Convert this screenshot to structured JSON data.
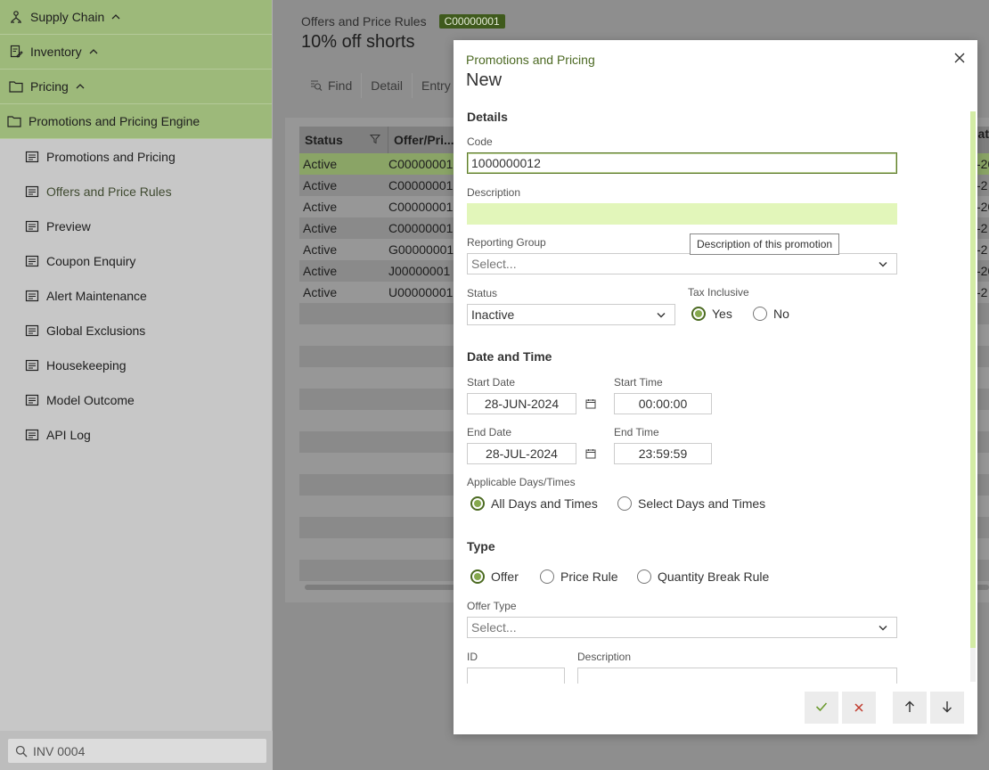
{
  "sidebar": {
    "groups": [
      {
        "label": "Supply Chain",
        "icon": "supply-chain-icon"
      },
      {
        "label": "Inventory",
        "icon": "inventory-icon"
      },
      {
        "label": "Pricing",
        "icon": "folder-icon"
      },
      {
        "label": "Promotions and Pricing Engine",
        "icon": "folder-icon"
      }
    ],
    "items": [
      {
        "label": "Promotions and Pricing"
      },
      {
        "label": "Offers and Price Rules"
      },
      {
        "label": "Preview"
      },
      {
        "label": "Coupon Enquiry"
      },
      {
        "label": "Alert Maintenance"
      },
      {
        "label": "Global Exclusions"
      },
      {
        "label": "Housekeeping"
      },
      {
        "label": "Model Outcome"
      },
      {
        "label": "API Log"
      }
    ],
    "search_value": "INV 0004"
  },
  "page": {
    "breadcrumb": "Offers and Price Rules",
    "code_badge": "C00000001",
    "title": "10% off shorts",
    "toolbar": {
      "find": "Find",
      "detail": "Detail",
      "entry": "Entry"
    }
  },
  "grid": {
    "columns": [
      "Status",
      "Offer/Pri..."
    ],
    "rows": [
      {
        "status": "Active",
        "code": "C00000001",
        "end": "-20"
      },
      {
        "status": "Active",
        "code": "C00000001",
        "end": "-2"
      },
      {
        "status": "Active",
        "code": "C00000001",
        "end": "-20"
      },
      {
        "status": "Active",
        "code": "C00000001",
        "end": "-2"
      },
      {
        "status": "Active",
        "code": "G00000001",
        "end": "-2"
      },
      {
        "status": "Active",
        "code": "J00000001",
        "end": "-20"
      },
      {
        "status": "Active",
        "code": "U00000001",
        "end": "-2"
      }
    ],
    "right_header": "at"
  },
  "modal": {
    "subtitle": "Promotions and Pricing",
    "title": "New",
    "details_heading": "Details",
    "code_label": "Code",
    "code_value": "1000000012",
    "description_label": "Description",
    "description_value": "",
    "tooltip": "Description of this promotion",
    "reporting_group_label": "Reporting Group",
    "reporting_group_placeholder": "Select...",
    "status_label": "Status",
    "status_value": "Inactive",
    "tax_inclusive_label": "Tax Inclusive",
    "tax_yes": "Yes",
    "tax_no": "No",
    "datetime_heading": "Date and Time",
    "start_date_label": "Start Date",
    "start_date_value": "28-JUN-2024",
    "start_time_label": "Start Time",
    "start_time_value": "00:00:00",
    "end_date_label": "End Date",
    "end_date_value": "28-JUL-2024",
    "end_time_label": "End Time",
    "end_time_value": "23:59:59",
    "applicable_label": "Applicable Days/Times",
    "applicable_all": "All Days and Times",
    "applicable_select": "Select Days and Times",
    "type_heading": "Type",
    "type_offer": "Offer",
    "type_price_rule": "Price Rule",
    "type_quantity_break": "Quantity Break Rule",
    "offer_type_label": "Offer Type",
    "offer_type_placeholder": "Select...",
    "id_label": "ID",
    "id_description_label": "Description"
  },
  "colors": {
    "accent": "#4c6b22",
    "highlight": "#e2f6ba",
    "sidebar_group": "#9db97a"
  }
}
